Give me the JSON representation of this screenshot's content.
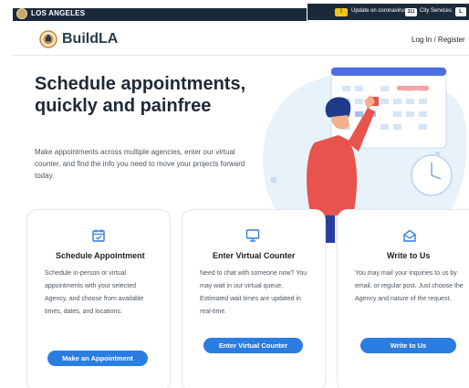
{
  "topbar": {
    "city_name": "LOS ANGELES",
    "alert_badge": "!",
    "alert_text": "Update on coronavirus",
    "services_badge": "311",
    "services_text": "City Services",
    "lang_badge": "L"
  },
  "header": {
    "logo_text": "BuildLA",
    "login_label": "Log In / Register"
  },
  "hero": {
    "title": "Schedule appointments, quickly and painfree",
    "description": "Make appointments across multiple agencies, enter our virtual counter, and find the info you need to move your projects forward today."
  },
  "cards": [
    {
      "icon": "calendar-check-icon",
      "title": "Schedule Appointment",
      "body": "Schedule in-person or virtual appointments with your selected Agency, and choose from available times, dates, and locations.",
      "button": "Make an Appointment"
    },
    {
      "icon": "monitor-icon",
      "title": "Enter Virtual Counter",
      "body": "Need to chat with someone now? You may wait in our virtual queue. Estimated wait times are updated in real-time.",
      "button": "Enter Virtual Counter"
    },
    {
      "icon": "open-envelope-icon",
      "title": "Write to Us",
      "body": "You may mail your inquiries to us by email, or regular post. Just choose the Agency and nature of the request.",
      "button": "Write to Us"
    }
  ],
  "colors": {
    "primary": "#2a7de1",
    "nav_dark": "#1b2a3a",
    "heading": "#1e2a36",
    "illustration_bg": "#e8f2fb"
  }
}
